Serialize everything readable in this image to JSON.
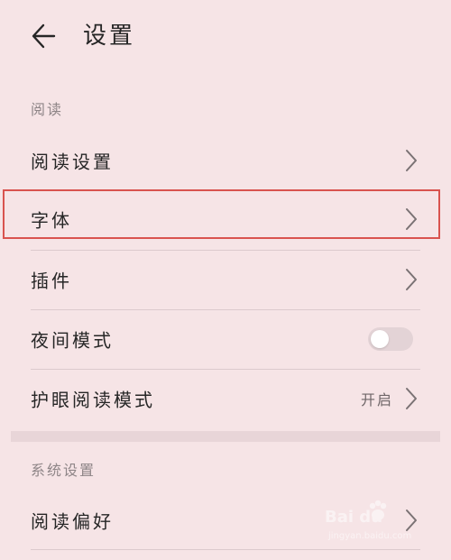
{
  "header": {
    "back_icon": "arrow-left-icon",
    "title": "设置"
  },
  "sections": [
    {
      "label": "阅读",
      "items": [
        {
          "label": "阅读设置",
          "control": "chevron"
        },
        {
          "label": "字体",
          "control": "chevron",
          "highlighted": true
        },
        {
          "label": "插件",
          "control": "chevron"
        },
        {
          "label": "夜间模式",
          "control": "toggle",
          "on": false
        },
        {
          "label": "护眼阅读模式",
          "control": "chevron",
          "value": "开启"
        }
      ]
    },
    {
      "label": "系统设置",
      "items": [
        {
          "label": "阅读偏好",
          "control": "chevron"
        }
      ]
    }
  ],
  "colors": {
    "background": "#f6e4e6",
    "highlight_border": "#d9534f",
    "divider": "#dccacd",
    "section_label": "#8e8587"
  },
  "watermark": {
    "brand": "Bai du",
    "sub": "jingyan.baidu.com"
  }
}
